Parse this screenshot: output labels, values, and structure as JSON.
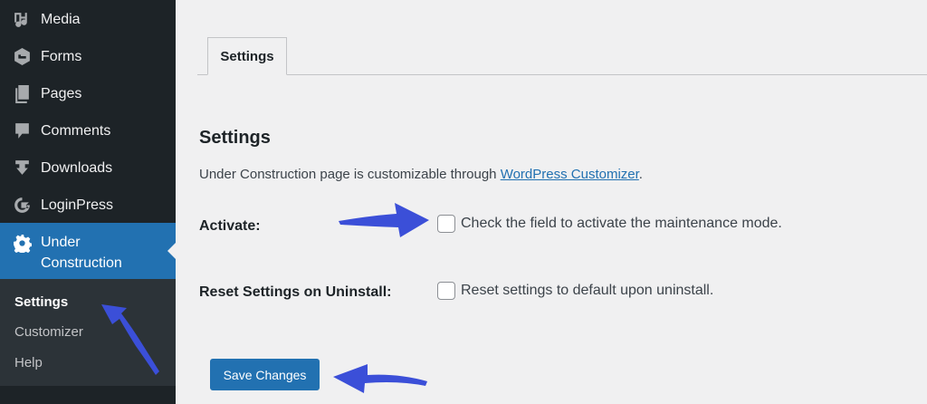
{
  "sidebar": {
    "items": [
      {
        "label": "Media",
        "icon": "media-icon"
      },
      {
        "label": "Forms",
        "icon": "forms-icon"
      },
      {
        "label": "Pages",
        "icon": "pages-icon"
      },
      {
        "label": "Comments",
        "icon": "comments-icon"
      },
      {
        "label": "Downloads",
        "icon": "downloads-icon"
      },
      {
        "label": "LoginPress",
        "icon": "loginpress-icon"
      },
      {
        "label": "Under Construction",
        "label_line1": "Under",
        "label_line2": "Construction",
        "icon": "gear-icon",
        "active": true
      }
    ],
    "submenu": [
      "Settings",
      "Customizer",
      "Help"
    ]
  },
  "main": {
    "tab": "Settings",
    "section_title": "Settings",
    "description_prefix": "Under Construction page is customizable through ",
    "description_link": "WordPress Customizer",
    "description_suffix": ".",
    "fields": [
      {
        "label": "Activate:",
        "checkbox_text": "Check the field to activate the maintenance mode.",
        "checked": false
      },
      {
        "label": "Reset Settings on Uninstall:",
        "checkbox_text": "Reset settings to default upon uninstall.",
        "checked": false
      }
    ],
    "save_label": "Save Changes"
  },
  "colors": {
    "sidebar_bg": "#1d2327",
    "active_bg": "#2271b1",
    "annotation_arrow": "#3b4fd8"
  }
}
